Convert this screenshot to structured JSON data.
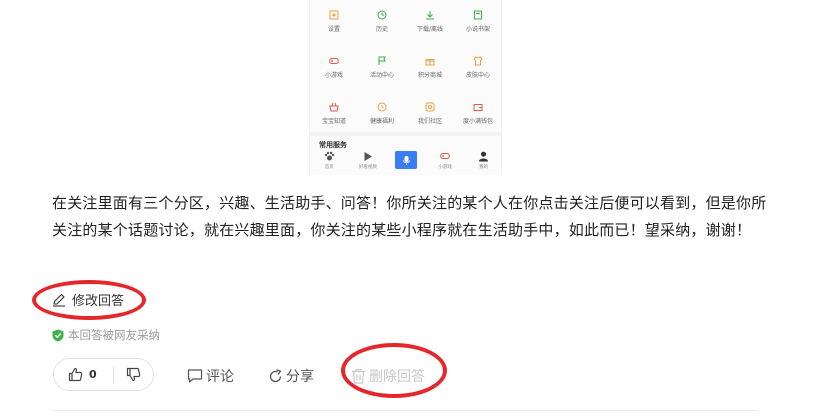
{
  "phone": {
    "grid": [
      [
        {
          "label": "设置",
          "icon": "settings-icon"
        },
        {
          "label": "历史",
          "icon": "history-icon"
        },
        {
          "label": "下载/离线",
          "icon": "download-icon"
        },
        {
          "label": "小说书架",
          "icon": "bookshelf-icon"
        }
      ],
      [
        {
          "label": "小游戏",
          "icon": "gamepad-icon"
        },
        {
          "label": "活动中心",
          "icon": "flag-icon"
        },
        {
          "label": "积分商城",
          "icon": "gift-icon"
        },
        {
          "label": "皮肤中心",
          "icon": "shirt-icon"
        }
      ],
      [
        {
          "label": "宝宝知道",
          "icon": "basket-icon"
        },
        {
          "label": "健康福利",
          "icon": "clock-icon"
        },
        {
          "label": "我们社区",
          "icon": "community-icon"
        },
        {
          "label": "度小满钱包",
          "icon": "wallet-icon"
        }
      ]
    ],
    "services_title": "常用服务",
    "tabs": [
      {
        "label": "首页",
        "icon": "paw-icon"
      },
      {
        "label": "好看视频",
        "icon": "play-icon"
      },
      {
        "label": "",
        "icon": "microphone-icon"
      },
      {
        "label": "小游戏",
        "icon": "gamepad-icon"
      },
      {
        "label": "我的",
        "icon": "user-icon"
      }
    ]
  },
  "answer": {
    "text": "在关注里面有三个分区，兴趣、生活助手、问答！你所关注的某个人在你点击关注后便可以看到，但是你所关注的某个话题讨论，就在兴趣里面，你关注的某些小程序就在生活助手中，如此而已！望采纳，谢谢！"
  },
  "edit_label": "修改回答",
  "adopted_label": "本回答被网友采纳",
  "vote": {
    "up_count": "0"
  },
  "actions": {
    "comment": "评论",
    "share": "分享",
    "delete": "删除回答"
  },
  "colors": {
    "annotation_ring": "#e5262b",
    "adopted_shield": "#3bb24a",
    "voice_button": "#3a7df5",
    "disabled_text": "#c8c8c8"
  }
}
